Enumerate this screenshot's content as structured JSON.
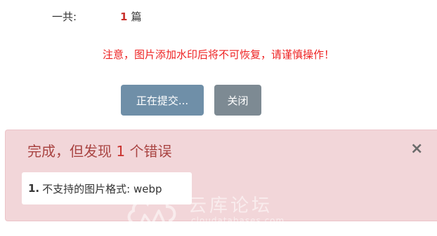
{
  "summary": {
    "total_label": "一共:",
    "total_count": "1",
    "total_unit": "篇"
  },
  "warning_text": "注意，图片添加水印后将不可恢复，请谨慎操作！",
  "buttons": {
    "submit_label": "正在提交...",
    "close_label": "关闭"
  },
  "alert": {
    "title_prefix": "完成，但发现",
    "error_count": "1",
    "title_suffix": "个错误",
    "close_symbol": "×",
    "errors": [
      {
        "index": "1.",
        "message": "不支持的图片格式: webp"
      }
    ]
  },
  "watermark": {
    "text": "云库论坛",
    "subtext": "cloudatabases.com"
  }
}
